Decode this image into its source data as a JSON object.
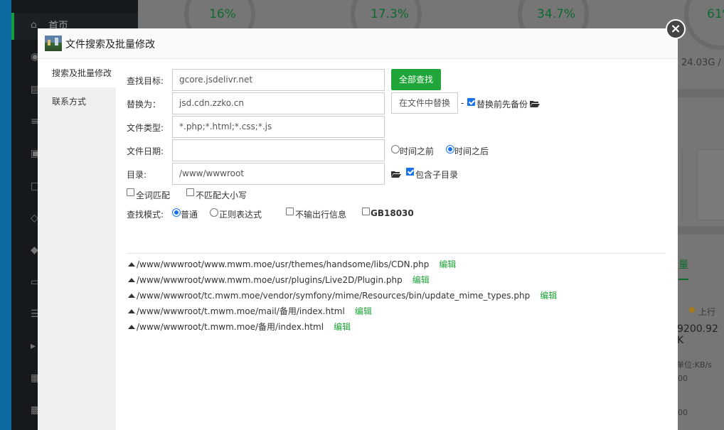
{
  "background": {
    "nav_home_label": "首页",
    "gauges": [
      "16%",
      "17.3%",
      "34.7%",
      "61%"
    ],
    "disk_text": "24.03G /",
    "traffic_tab": "量",
    "upload_label": "上行",
    "upload_value": "9200.92 K",
    "unit_label": "单位:KB/s",
    "axis_ticks": [
      "00",
      "00"
    ]
  },
  "modal": {
    "title": "文件搜索及批量修改",
    "close_symbol": "×",
    "sidebar": [
      {
        "label": "搜索及批量修改",
        "active": true
      },
      {
        "label": "联系方式",
        "active": false
      }
    ],
    "form": {
      "search_target_label": "查找目标:",
      "search_target_value": "gcore.jsdelivr.net",
      "search_all_button": "全部查找",
      "replace_label": "替换为：",
      "replace_value": "jsd.cdn.zzko.cn",
      "replace_in_file_button": "在文件中替换",
      "dash": "-",
      "backup_before_replace": {
        "label": "替换前先备份",
        "checked": true
      },
      "file_type_label": "文件类型:",
      "file_type_value": "*.php;*.html;*.css;*.js",
      "file_date_label": "文件日期:",
      "file_date_value": "",
      "time_before": {
        "label": "时间之前",
        "checked": false
      },
      "time_after": {
        "label": "时间之后",
        "checked": true
      },
      "dir_label": "目录:",
      "dir_value": "/www/wwwroot",
      "include_subdirs": {
        "label": "包含子目录",
        "checked": true
      },
      "whole_word": {
        "label": "全词匹配",
        "checked": false
      },
      "ignore_case": {
        "label": "不匹配大小写",
        "checked": false
      },
      "mode_label": "查找模式:",
      "mode_normal": {
        "label": "普通",
        "checked": true
      },
      "mode_regex": {
        "label": "正则表达式",
        "checked": false
      },
      "no_output": {
        "label": "不输出行信息",
        "checked": false
      },
      "gb18030": {
        "label": "GB18030",
        "checked": false
      }
    },
    "edit_label": "编辑",
    "results": [
      "/www/wwwroot/www.mwm.moe/usr/themes/handsome/libs/CDN.php",
      "/www/wwwroot/www.mwm.moe/usr/plugins/Live2D/Plugin.php",
      "/www/wwwroot/tc.mwm.moe/vendor/symfony/mime/Resources/bin/update_mime_types.php",
      "/www/wwwroot/t.mwm.moe/mail/备用/index.html",
      "/www/wwwroot/t.mwm.moe/备用/index.html"
    ],
    "colors": {
      "primary_green": "#20a53a",
      "checkbox_blue": "#1a73e8"
    }
  }
}
